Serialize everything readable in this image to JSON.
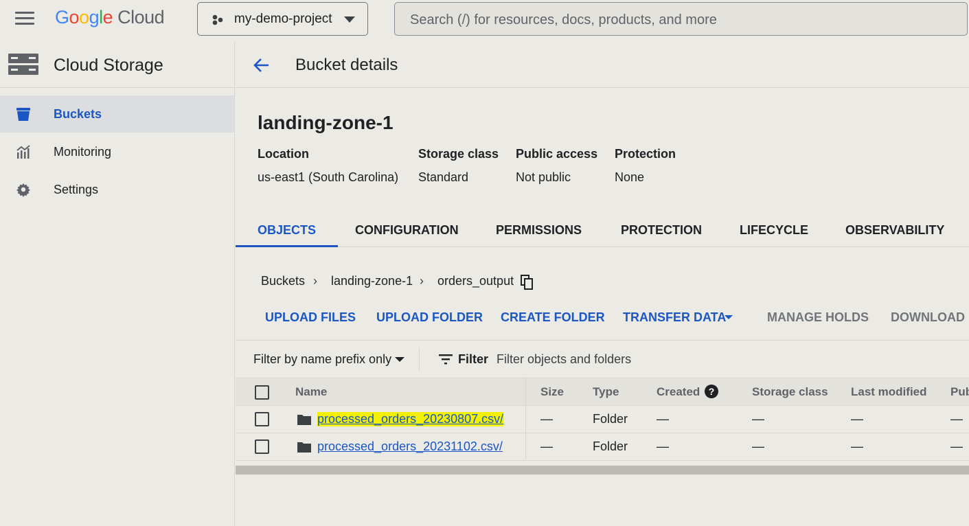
{
  "topbar": {
    "logo": {
      "google": "Google",
      "cloud": "Cloud"
    },
    "project": {
      "name": "my-demo-project"
    },
    "search": {
      "placeholder": "Search (/) for resources, docs, products, and more"
    }
  },
  "sidebar": {
    "title": "Cloud Storage",
    "items": [
      {
        "label": "Buckets",
        "icon": "bucket-icon",
        "active": true
      },
      {
        "label": "Monitoring",
        "icon": "monitoring-icon",
        "active": false
      },
      {
        "label": "Settings",
        "icon": "gear-icon",
        "active": false
      }
    ]
  },
  "header": {
    "title": "Bucket details"
  },
  "bucket": {
    "name": "landing-zone-1",
    "meta": [
      {
        "key": "Location",
        "value": "us-east1 (South Carolina)"
      },
      {
        "key": "Storage class",
        "value": "Standard"
      },
      {
        "key": "Public access",
        "value": "Not public"
      },
      {
        "key": "Protection",
        "value": "None"
      }
    ]
  },
  "tabs": [
    {
      "label": "OBJECTS",
      "active": true
    },
    {
      "label": "CONFIGURATION"
    },
    {
      "label": "PERMISSIONS"
    },
    {
      "label": "PROTECTION"
    },
    {
      "label": "LIFECYCLE"
    },
    {
      "label": "OBSERVABILITY"
    }
  ],
  "breadcrumb": [
    "Buckets",
    "landing-zone-1",
    "orders_output"
  ],
  "actions": [
    {
      "label": "UPLOAD FILES",
      "enabled": true
    },
    {
      "label": "UPLOAD FOLDER",
      "enabled": true
    },
    {
      "label": "CREATE FOLDER",
      "enabled": true
    },
    {
      "label": "TRANSFER DATA",
      "enabled": true
    },
    {
      "label": "MANAGE HOLDS",
      "enabled": false
    },
    {
      "label": "DOWNLOAD",
      "enabled": false
    }
  ],
  "filter": {
    "prefix_label": "Filter by name prefix only",
    "filter_label": "Filter",
    "placeholder": "Filter objects and folders"
  },
  "table": {
    "columns": [
      "Name",
      "Size",
      "Type",
      "Created",
      "Storage class",
      "Last modified",
      "Pub"
    ],
    "help_glyph": "?",
    "rows": [
      {
        "name": "processed_orders_20230807.csv/",
        "size": "—",
        "type": "Folder",
        "created": "—",
        "storage_class": "—",
        "last_modified": "—",
        "public": "—",
        "highlighted": true
      },
      {
        "name": "processed_orders_20231102.csv/",
        "size": "—",
        "type": "Folder",
        "created": "—",
        "storage_class": "—",
        "last_modified": "—",
        "public": "—",
        "highlighted": false
      }
    ]
  },
  "colors": {
    "accent": "#1a56c4",
    "background": "#eceae5",
    "highlight": "#f2f200"
  }
}
